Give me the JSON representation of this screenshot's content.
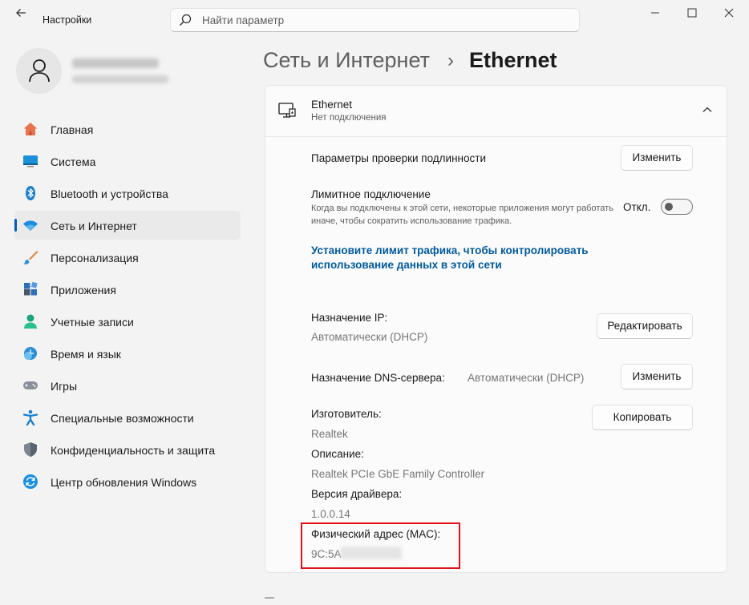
{
  "app": {
    "title": "Настройки"
  },
  "search": {
    "placeholder": "Найти параметр"
  },
  "window_controls": {
    "minimize": "—",
    "maximize": "☐",
    "close": "✕"
  },
  "nav": {
    "items": [
      {
        "label": "Главная",
        "icon": "home-icon"
      },
      {
        "label": "Система",
        "icon": "system-icon"
      },
      {
        "label": "Bluetooth и устройства",
        "icon": "bluetooth-icon"
      },
      {
        "label": "Сеть и Интернет",
        "icon": "wifi-icon",
        "selected": true
      },
      {
        "label": "Персонализация",
        "icon": "brush-icon"
      },
      {
        "label": "Приложения",
        "icon": "apps-icon"
      },
      {
        "label": "Учетные записи",
        "icon": "account-icon"
      },
      {
        "label": "Время и язык",
        "icon": "time-language-icon"
      },
      {
        "label": "Игры",
        "icon": "gamepad-icon"
      },
      {
        "label": "Специальные возможности",
        "icon": "accessibility-icon"
      },
      {
        "label": "Конфиденциальность и защита",
        "icon": "shield-icon"
      },
      {
        "label": "Центр обновления Windows",
        "icon": "update-icon"
      }
    ]
  },
  "breadcrumb": {
    "parent": "Сеть и Интернет",
    "separator": "›",
    "current": "Ethernet"
  },
  "ethernet": {
    "title": "Ethernet",
    "status": "Нет подключения",
    "auth_label": "Параметры проверки подлинности",
    "auth_button": "Изменить",
    "metered_label": "Лимитное подключение",
    "metered_desc": "Когда вы подключены к этой сети, некоторые приложения могут работать иначе, чтобы сократить использование трафика.",
    "metered_state": "Откл.",
    "metered_on": false,
    "data_limit_link": "Установите лимит трафика, чтобы контролировать использование данных в этой сети",
    "ip_label": "Назначение IP:",
    "ip_value": "Автоматически (DHCP)",
    "ip_button": "Редактировать",
    "dns_label": "Назначение DNS-сервера:",
    "dns_value": "Автоматически (DHCP)",
    "dns_button": "Изменить",
    "manufacturer_label": "Изготовитель:",
    "manufacturer_value": "Realtek",
    "copy_button": "Копировать",
    "description_label": "Описание:",
    "description_value": "Realtek PCIe GbE Family Controller",
    "driver_label": "Версия драйвера:",
    "driver_value": "1.0.0.14",
    "mac_label": "Физический адрес (MAC):",
    "mac_value": "9C:5A"
  },
  "colors": {
    "accent": "#005fb8",
    "highlight_box": "#e0131b",
    "link": "#005a9e"
  }
}
